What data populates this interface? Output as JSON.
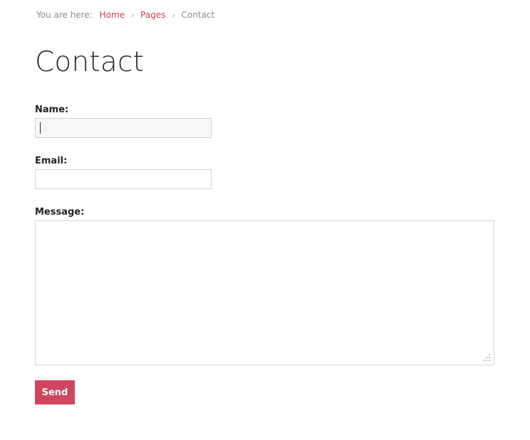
{
  "breadcrumb": {
    "prefix": "You are here:",
    "items": [
      "Home",
      "Pages"
    ],
    "separator": "›",
    "current": "Contact"
  },
  "page": {
    "title": "Contact"
  },
  "form": {
    "name_label": "Name:",
    "name_value": "",
    "email_label": "Email:",
    "email_value": "",
    "message_label": "Message:",
    "message_value": "",
    "send_label": "Send"
  },
  "colors": {
    "link": "#c94159",
    "button": "#d0465e",
    "text": "#2b2b2b",
    "muted": "#8c8c8c"
  }
}
